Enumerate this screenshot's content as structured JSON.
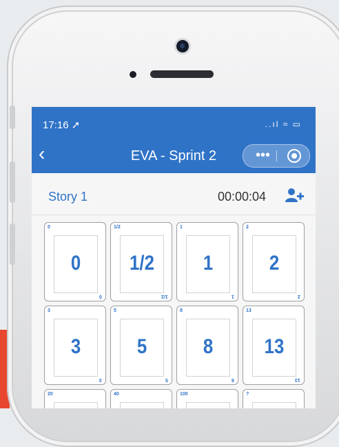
{
  "status": {
    "time": "17:16 ➚",
    "icons": "..ıl ≈ ▭"
  },
  "nav": {
    "back": "‹",
    "title": "EVA - Sprint 2",
    "more": "•••"
  },
  "story": {
    "name": "Story 1",
    "timer": "00:00:04"
  },
  "cards": [
    "0",
    "1/2",
    "1",
    "2",
    "3",
    "5",
    "8",
    "13",
    "20",
    "40",
    "100",
    "?"
  ],
  "colors": {
    "accent": "#2f73c7",
    "red": "#e8472f"
  }
}
